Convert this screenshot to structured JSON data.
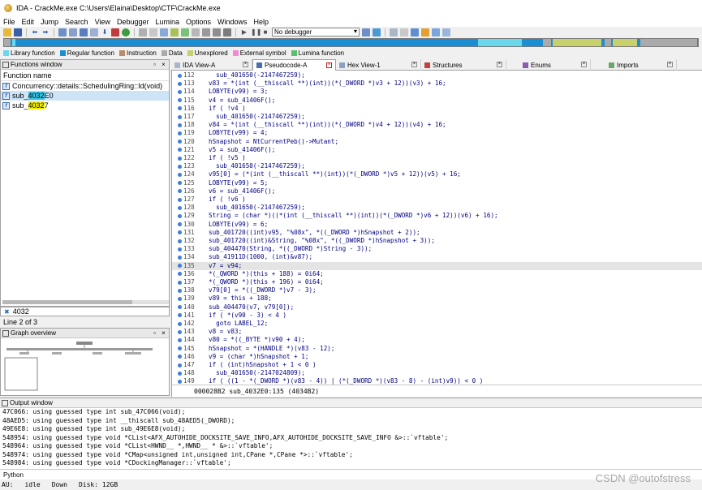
{
  "window": {
    "title": "IDA - CrackMe.exe C:\\Users\\Elaina\\Desktop\\CTF\\CrackMe.exe"
  },
  "menu": [
    "File",
    "Edit",
    "Jump",
    "Search",
    "View",
    "Debugger",
    "Lumina",
    "Options",
    "Windows",
    "Help"
  ],
  "toolbar": {
    "debugger_label": "No debugger"
  },
  "legend": [
    {
      "label": "Library function",
      "color": "#69d7ec"
    },
    {
      "label": "Regular function",
      "color": "#1b8fd4"
    },
    {
      "label": "Instruction",
      "color": "#b98b6a"
    },
    {
      "label": "Data",
      "color": "#aaaaaa"
    },
    {
      "label": "Unexplored",
      "color": "#c8d06b"
    },
    {
      "label": "External symbol",
      "color": "#f28ad8"
    },
    {
      "label": "Lumina function",
      "color": "#56c26e"
    }
  ],
  "functions_window": {
    "title": "Functions window",
    "column_header": "Function name",
    "items": [
      {
        "pre": "Concurrency::details::SchedulingRing::Id(void)",
        "hl": "",
        "post": ""
      },
      {
        "pre": "sub_",
        "hl": "4032",
        "post": "E0"
      },
      {
        "pre": "sub_",
        "hl": "4032",
        "post": "7"
      }
    ],
    "search_value": "4032",
    "line_status": "Line 2 of 3"
  },
  "graph_overview": {
    "title": "Graph overview"
  },
  "tabs": [
    {
      "label": "IDA View-A",
      "active": false
    },
    {
      "label": "Pseudocode-A",
      "active": true
    },
    {
      "label": "Hex View-1",
      "active": false
    },
    {
      "label": "Structures",
      "active": false
    },
    {
      "label": "Enums",
      "active": false
    },
    {
      "label": "Imports",
      "active": false
    }
  ],
  "code": {
    "current_line": 135,
    "lines": [
      {
        "n": "112",
        "t": "  sub_401650(-2147467259);"
      },
      {
        "n": "113",
        "t": "v83 = *(int (__thiscall **)(int))(*(_DWORD *)v3 + 12))(v3) + 16;"
      },
      {
        "n": "114",
        "t": "LOBYTE(v99) = 3;"
      },
      {
        "n": "115",
        "t": "v4 = sub_41406F();"
      },
      {
        "n": "116",
        "t": "if ( !v4 )"
      },
      {
        "n": "117",
        "t": "  sub_401650(-2147467259);"
      },
      {
        "n": "118",
        "t": "v84 = *(int (__thiscall **)(int))(*(_DWORD *)v4 + 12))(v4) + 16;"
      },
      {
        "n": "119",
        "t": "LOBYTE(v99) = 4;"
      },
      {
        "n": "120",
        "t": "hSnapshot = NtCurrentPeb()->Mutant;"
      },
      {
        "n": "121",
        "t": "v5 = sub_41406F();"
      },
      {
        "n": "122",
        "t": "if ( !v5 )"
      },
      {
        "n": "123",
        "t": "  sub_401650(-2147467259);"
      },
      {
        "n": "124",
        "t": "v95[0] = (*(int (__thiscall **)(int))(*(_DWORD *)v5 + 12))(v5) + 16;"
      },
      {
        "n": "125",
        "t": "LOBYTE(v99) = 5;"
      },
      {
        "n": "126",
        "t": "v6 = sub_41406F();"
      },
      {
        "n": "127",
        "t": "if ( !v6 )"
      },
      {
        "n": "128",
        "t": "  sub_401650(-2147467259);"
      },
      {
        "n": "129",
        "t": "String = (char *)((*(int (__thiscall **)(int))(*(_DWORD *)v6 + 12))(v6) + 16);"
      },
      {
        "n": "130",
        "t": "LOBYTE(v99) = 6;"
      },
      {
        "n": "131",
        "t": "sub_401720((int)v95, \"%08x\", *((_DWORD *)hSnapshot + 2));"
      },
      {
        "n": "132",
        "t": "sub_401720((int)&String, \"%08x\", *((_DWORD *)hSnapshot + 3));"
      },
      {
        "n": "133",
        "t": "sub_404470(String, *((_DWORD *)String - 3));"
      },
      {
        "n": "134",
        "t": "sub_41911D(1000, (int)&v87);"
      },
      {
        "n": "135",
        "t": "v7 = v94;"
      },
      {
        "n": "136",
        "t": "*(_QWORD *)(this + 188) = 0i64;"
      },
      {
        "n": "137",
        "t": "*(_QWORD *)(this + 196) = 0i64;"
      },
      {
        "n": "138",
        "t": "v79[0] = *((_DWORD *)v7 - 3);"
      },
      {
        "n": "139",
        "t": "v89 = this + 188;"
      },
      {
        "n": "140",
        "t": "sub_404470(v7, v79[0]);"
      },
      {
        "n": "141",
        "t": "if ( *(v90 - 3) < 4 )"
      },
      {
        "n": "142",
        "t": "  goto LABEL_12;"
      },
      {
        "n": "143",
        "t": "v8 = v83;"
      },
      {
        "n": "144",
        "t": "v80 = *((_BYTE *)v90 + 4);"
      },
      {
        "n": "145",
        "t": "hSnapshot = *(HANDLE *)(v83 - 12);"
      },
      {
        "n": "146",
        "t": "v9 = (char *)hSnapshot + 1;"
      },
      {
        "n": "147",
        "t": "if ( (int)hSnapshot + 1 < 0 )"
      },
      {
        "n": "148",
        "t": "  sub_401650(-2147024809);"
      },
      {
        "n": "149",
        "t": "if ( ((1 - *(_DWORD *)(v83 - 4)) | (*(_DWORD *)(v83 - 8) - (int)v9)) < 0 )"
      }
    ],
    "status": "000028B2 sub_4032E0:135 (4034B2)"
  },
  "output": {
    "title": "Output window",
    "lines": [
      "47C066: using guessed type int sub_47C066(void);",
      "48AED5: using guessed type int __thiscall sub_48AED5(_DWORD);",
      "49E6E8: using guessed type int sub_49E6E8(void);",
      "548954: using guessed type void *CList<AFX_AUTOHIDE_DOCKSITE_SAVE_INFO,AFX_AUTOHIDE_DOCKSITE_SAVE_INFO &>::`vftable';",
      "548964: using guessed type void *CList<HWND__ *,HWND__ * &>::`vftable';",
      "548974: using guessed type void *CMap<unsigned int,unsigned int,CPane *,CPane *>::`vftable';",
      "548984: using guessed type void *CDockingManager::`vftable';"
    ],
    "python_label": "Python"
  },
  "statusbar": {
    "au": "AU:",
    "state": "idle",
    "direction": "Down",
    "disk": "Disk: 12GB"
  },
  "watermark": "CSDN @outofstress"
}
